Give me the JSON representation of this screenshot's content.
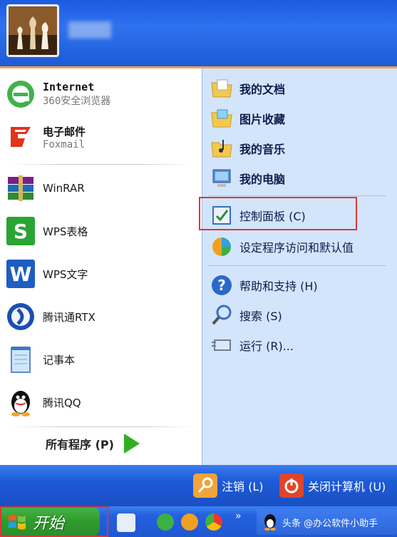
{
  "header": {
    "username": ""
  },
  "left": {
    "pinned": [
      {
        "title": "Internet",
        "subtitle": "360安全浏览器",
        "icon": "ie-browser-icon"
      },
      {
        "title": "电子邮件",
        "subtitle": "Foxmail",
        "icon": "foxmail-icon"
      }
    ],
    "recent": [
      {
        "label": "WinRAR",
        "icon": "winrar-icon"
      },
      {
        "label": "WPS表格",
        "icon": "wps-spreadsheet-icon"
      },
      {
        "label": "WPS文字",
        "icon": "wps-writer-icon"
      },
      {
        "label": "腾讯通RTX",
        "icon": "rtx-icon"
      },
      {
        "label": "记事本",
        "icon": "notepad-icon"
      },
      {
        "label": "腾讯QQ",
        "icon": "qq-icon"
      }
    ],
    "all_programs": "所有程序 (P)"
  },
  "right": {
    "places": [
      {
        "label": "我的文档",
        "icon": "my-documents-folder-icon"
      },
      {
        "label": "图片收藏",
        "icon": "my-pictures-folder-icon"
      },
      {
        "label": "我的音乐",
        "icon": "my-music-folder-icon"
      },
      {
        "label": "我的电脑",
        "icon": "my-computer-icon"
      }
    ],
    "control_panel": "控制面板 (C)",
    "set_defaults": "设定程序访问和默认值",
    "help": "帮助和支持 (H)",
    "search": "搜索 (S)",
    "run": "运行 (R)..."
  },
  "bottom": {
    "logoff": "注销 (L)",
    "shutdown": "关闭计算机 (U)"
  },
  "taskbar": {
    "start": "开始",
    "overflow": "»",
    "task_label": "头条 @办公软件小助手"
  },
  "colors": {
    "highlight_box": "#e0353b",
    "start_green": "#2e9a2c",
    "header_blue": "#1b5be0"
  }
}
